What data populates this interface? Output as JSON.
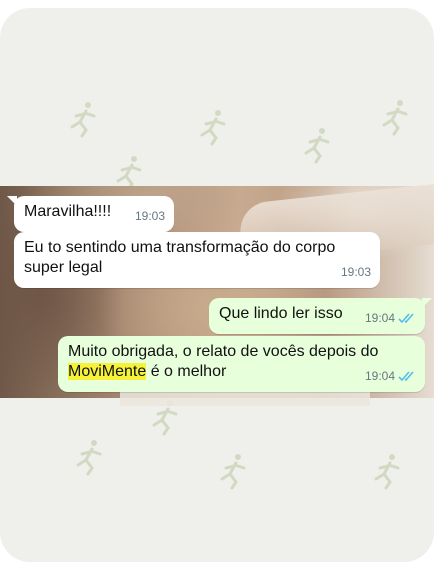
{
  "colors": {
    "background": "#eff0eb",
    "incoming_bubble": "#ffffff",
    "outgoing_bubble": "#e7ffdb",
    "read_ticks": "#53bdeb",
    "highlight": "#f6f23a"
  },
  "watermark_icon": "running-person-icon",
  "messages": [
    {
      "direction": "incoming",
      "text": "Maravilha!!!!",
      "time": "19:03"
    },
    {
      "direction": "incoming",
      "text_line1": "Eu to sentindo uma transformação do corpo",
      "text_line2": "super legal",
      "time": "19:03"
    },
    {
      "direction": "outgoing",
      "text": "Que lindo ler isso",
      "time": "19:04",
      "status": "read"
    },
    {
      "direction": "outgoing",
      "text_line1": "Muito obrigada, o relato de vocês depois do",
      "highlight": "MoviMente",
      "text_rest": " é o melhor",
      "time": "19:04",
      "status": "read"
    }
  ]
}
